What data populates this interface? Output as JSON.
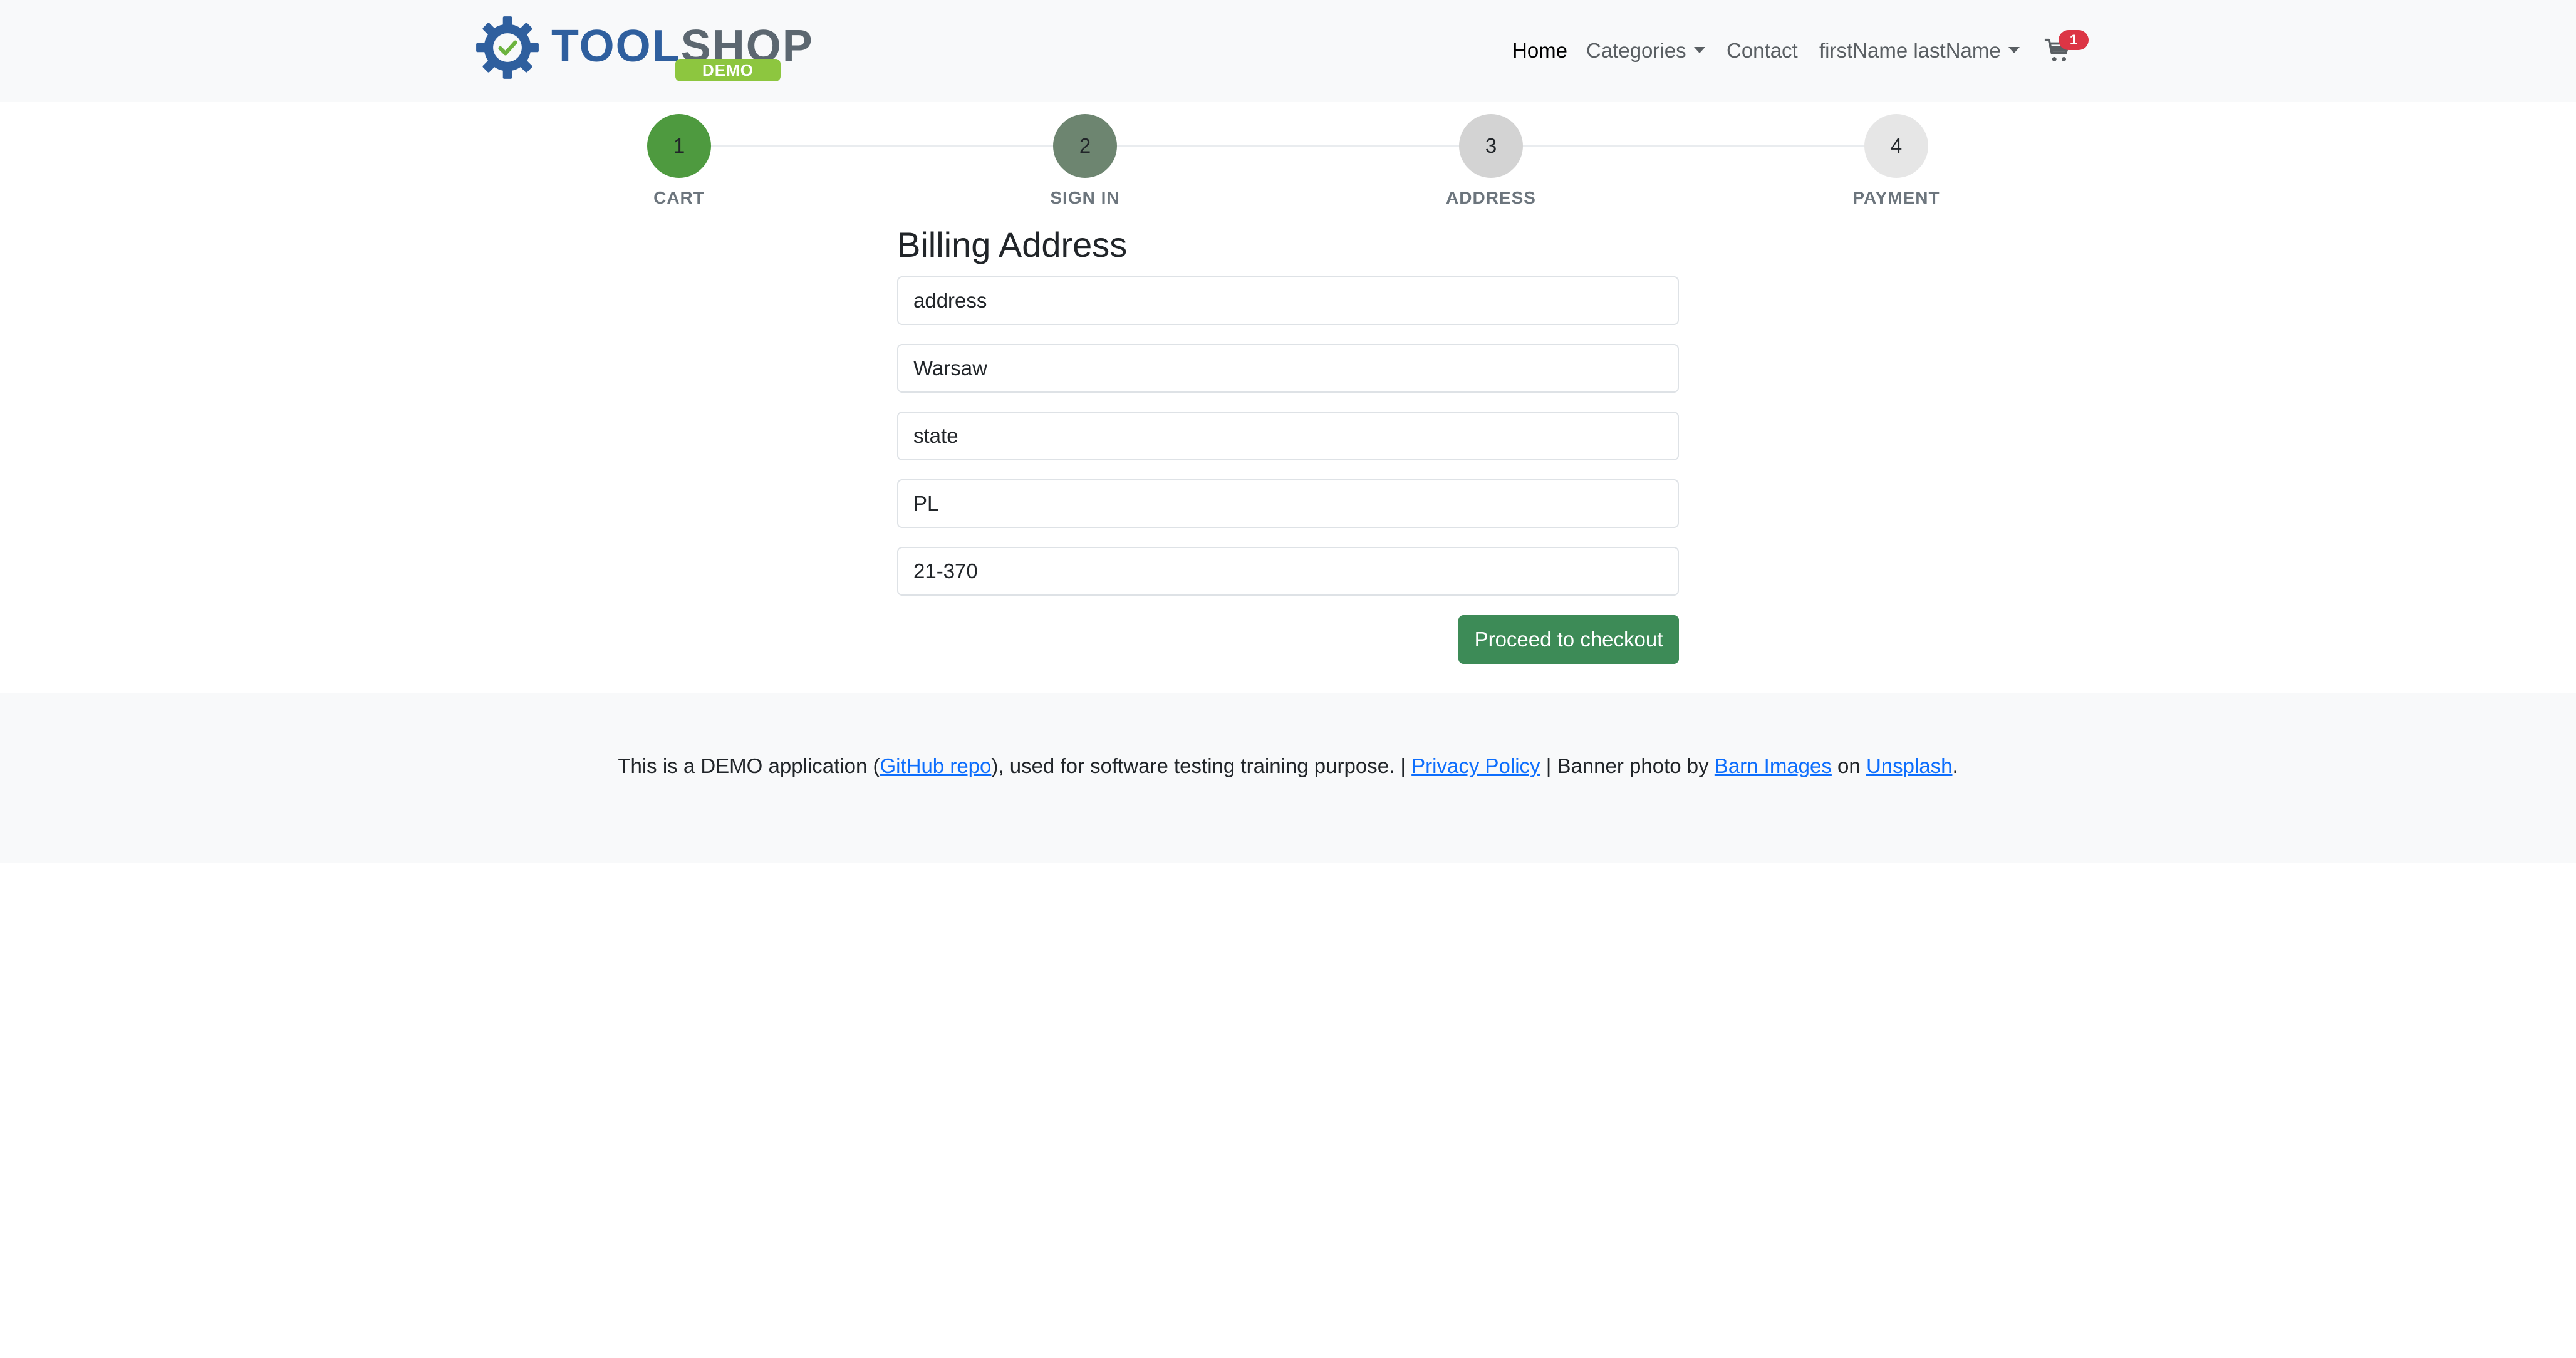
{
  "brand": {
    "name_part1": "TOOL",
    "name_part2": "SHOP",
    "badge": "DEMO",
    "logo_icon": "gear-check-icon"
  },
  "nav": {
    "home": "Home",
    "categories": "Categories",
    "contact": "Contact",
    "user": "firstName lastName",
    "cart_count": "1",
    "cart_icon": "cart-icon"
  },
  "steps": [
    {
      "number": "1",
      "label": "CART",
      "color": "#4e9a3f"
    },
    {
      "number": "2",
      "label": "SIGN IN",
      "color": "#6d8570"
    },
    {
      "number": "3",
      "label": "ADDRESS",
      "color": "#d3d3d3"
    },
    {
      "number": "4",
      "label": "PAYMENT",
      "color": "#e6e6e6"
    }
  ],
  "form": {
    "title": "Billing Address",
    "address": "address",
    "city": "Warsaw",
    "state": "state",
    "country": "PL",
    "postcode": "21-370",
    "submit": "Proceed to checkout"
  },
  "footer": {
    "part1": "This is a DEMO application (",
    "github_link": "GitHub repo",
    "part2": "), used for software testing training purpose. | ",
    "privacy_link": "Privacy Policy",
    "part3": " | Banner photo by ",
    "barn_link": "Barn Images",
    "part4": " on ",
    "unsplash_link": "Unsplash",
    "part5": "."
  },
  "colors": {
    "primary_button": "#3d8b57",
    "badge": "#dc3545",
    "link": "#0d6efd"
  }
}
